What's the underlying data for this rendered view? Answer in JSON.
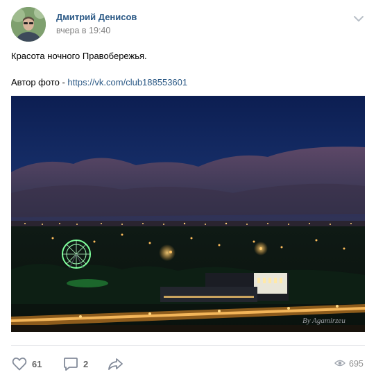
{
  "post": {
    "author_name": "Дмитрий Денисов",
    "timestamp": "вчера в 19:40",
    "text_line1": "Красота ночного Правобережья.",
    "text_line2_prefix": "Автор фото - ",
    "text_line2_link": "https://vk.com/club188553601",
    "photo_signature": "By Agamirzeu",
    "more_icon": "chevron-down-icon"
  },
  "actions": {
    "like": {
      "icon": "heart-icon",
      "count": "61"
    },
    "comment": {
      "icon": "speech-bubble-icon",
      "count": "2"
    },
    "share": {
      "icon": "share-arrow-icon"
    },
    "views": {
      "icon": "eye-icon",
      "count": "695"
    }
  },
  "colors": {
    "link": "#2a5885",
    "muted": "#828282",
    "divider": "#e7e8ec",
    "action": "#656565"
  }
}
